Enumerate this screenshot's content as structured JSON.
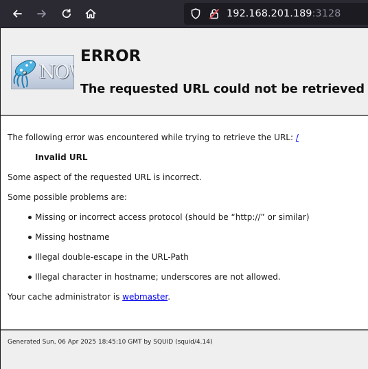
{
  "browser": {
    "url_host": "192.168.201.189",
    "url_port": ":3128",
    "icons": {
      "back": "back-arrow-icon",
      "forward": "forward-arrow-icon",
      "reload": "reload-icon",
      "home": "home-icon",
      "shield": "tracking-protection-shield-icon",
      "lock": "insecure-lock-icon"
    }
  },
  "header": {
    "logo_text": "NOW",
    "title": "ERROR",
    "subtitle": "The requested URL could not be retrieved"
  },
  "body": {
    "intro": "The following error was encountered while trying to retrieve the URL:",
    "requested_url": "/",
    "error_name": "Invalid URL",
    "description": "Some aspect of the requested URL is incorrect.",
    "problems_heading": "Some possible problems are:",
    "problems": [
      "Missing or incorrect access protocol (should be “http://” or similar)",
      "Missing hostname",
      "Illegal double-escape in the URL-Path",
      "Illegal character in hostname; underscores are not allowed."
    ],
    "admin_prefix": "Your cache administrator is",
    "admin_link": "webmaster",
    "admin_suffix": "."
  },
  "footer": {
    "text": "Generated Sun, 06 Apr 2025 18:45:10 GMT by SQUID (squid/4.14)"
  },
  "colors": {
    "toolbar_bg": "#2b2a33",
    "urlbar_bg": "#1c1b22",
    "section_bg": "#efefef",
    "link": "#0000ee",
    "lock_warning": "#ff4f5e"
  }
}
